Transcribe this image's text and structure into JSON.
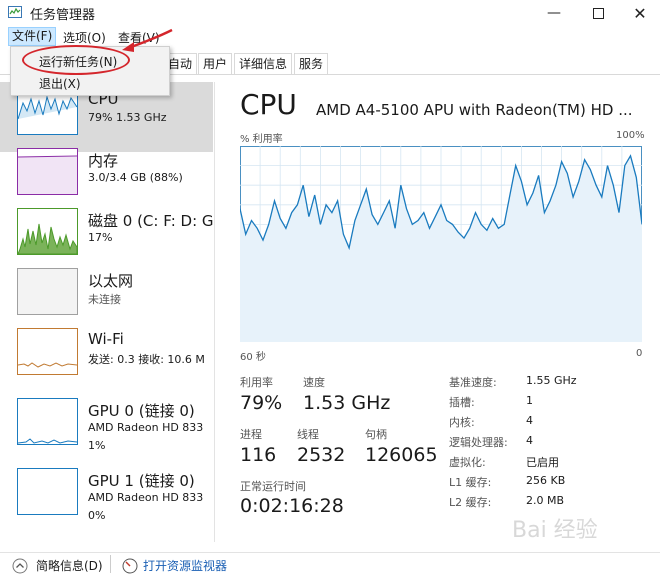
{
  "window": {
    "title": "任务管理器"
  },
  "menubar": {
    "file": "文件(F)",
    "options": "选项(O)",
    "view": "查看(V)"
  },
  "file_menu": {
    "run_new_task": "运行新任务(N)",
    "exit": "退出(X)"
  },
  "tabs": [
    "自动",
    "用户",
    "详细信息",
    "服务"
  ],
  "sidebar": {
    "items": [
      {
        "name": "CPU",
        "sub1": "79%  1.53 GHz",
        "color": "#1a7bbf"
      },
      {
        "name": "内存",
        "sub1": "3.0/3.4 GB (88%)",
        "color": "#8b2ca6"
      },
      {
        "name": "磁盘 0 (C: F: D: G",
        "sub1": "17%",
        "color": "#4c9a2a"
      },
      {
        "name": "以太网",
        "sub1": "未连接",
        "color": "#a0a0a0"
      },
      {
        "name": "Wi-Fi",
        "sub1": "发送: 0.3  接收: 10.6 M",
        "color": "#c17a32"
      },
      {
        "name": "GPU 0 (链接 0)",
        "sub1": "AMD Radeon HD 833",
        "sub2": "1%",
        "color": "#1a7bbf"
      },
      {
        "name": "GPU 1 (链接 0)",
        "sub1": "AMD Radeon HD 833",
        "sub2": "0%",
        "color": "#1a7bbf"
      }
    ]
  },
  "main": {
    "title": "CPU",
    "model": "AMD A4-5100 APU with Radeon(TM) HD ...",
    "utilization_label": "% 利用率",
    "max_label": "100%",
    "time_label": "60 秒",
    "zero_label": "0",
    "cpu_graph": [
      68,
      55,
      62,
      58,
      52,
      60,
      72,
      63,
      58,
      66,
      70,
      80,
      64,
      75,
      60,
      70,
      66,
      72,
      55,
      48,
      62,
      70,
      78,
      65,
      60,
      66,
      72,
      58,
      80,
      68,
      60,
      62,
      66,
      58,
      64,
      70,
      62,
      60,
      56,
      53,
      58,
      66,
      60,
      57,
      63,
      58,
      60,
      75,
      90,
      82,
      70,
      76,
      85,
      66,
      72,
      80,
      92,
      86,
      74,
      82,
      93,
      88,
      80,
      74,
      90,
      80,
      66,
      90,
      95,
      84,
      60
    ]
  },
  "stats": {
    "util_label": "利用率",
    "util_value": "79%",
    "speed_label": "速度",
    "speed_value": "1.53 GHz",
    "proc_label": "进程",
    "proc_value": "116",
    "thread_label": "线程",
    "thread_value": "2532",
    "handle_label": "句柄",
    "handle_value": "126065",
    "uptime_label": "正常运行时间",
    "uptime_value": "0:02:16:28"
  },
  "specs": [
    {
      "key": "基准速度:",
      "value": "1.55 GHz"
    },
    {
      "key": "插槽:",
      "value": "1"
    },
    {
      "key": "内核:",
      "value": "4"
    },
    {
      "key": "逻辑处理器:",
      "value": "4"
    },
    {
      "key": "虚拟化:",
      "value": "已启用"
    },
    {
      "key": "L1 缓存:",
      "value": "256 KB"
    },
    {
      "key": "L2 缓存:",
      "value": "2.0 MB"
    }
  ],
  "bottom": {
    "fewer_details": "简略信息(D)",
    "resource_monitor": "打开资源监视器"
  },
  "watermark": "Bai 经验"
}
